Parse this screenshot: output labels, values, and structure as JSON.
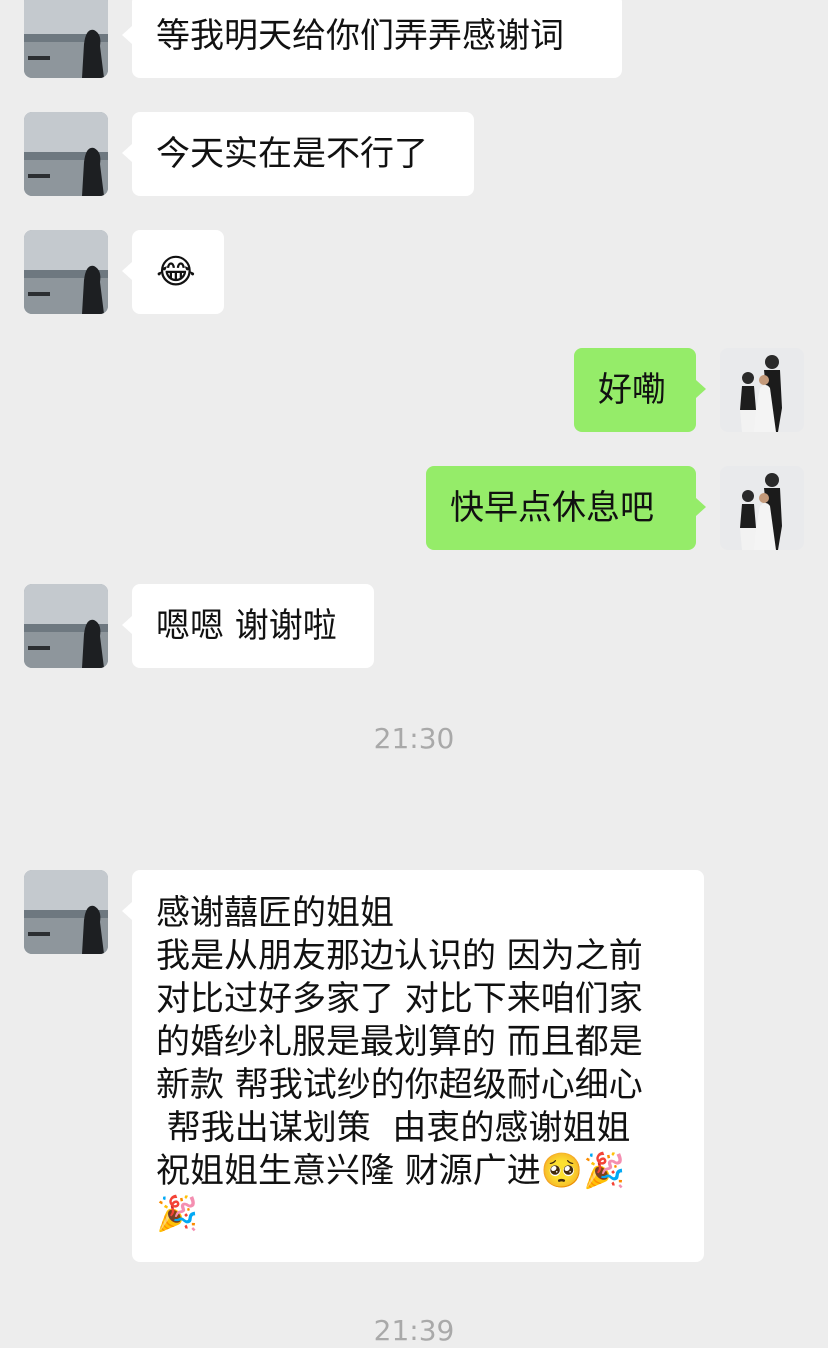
{
  "messages": [
    {
      "id": "m1",
      "side": "left",
      "text": "等我明天给你们弄弄感谢词"
    },
    {
      "id": "m2",
      "side": "left",
      "text": "今天实在是不行了"
    },
    {
      "id": "m3",
      "side": "left",
      "text": "😂"
    },
    {
      "id": "m4",
      "side": "right",
      "text": "好嘞"
    },
    {
      "id": "m5",
      "side": "right",
      "text": "快早点休息吧"
    },
    {
      "id": "m6",
      "side": "left",
      "text": "嗯嗯 谢谢啦"
    },
    {
      "id": "m7",
      "side": "left",
      "lines": [
        "感谢囍匠的姐姐",
        "我是从朋友那边认识的 因为之前",
        "对比过好多家了 对比下来咱们家",
        "的婚纱礼服是最划算的 而且都是",
        "新款 帮我试纱的你超级耐心细心",
        " 帮我出谋划策  由衷的感谢姐姐",
        "祝姐姐生意兴隆 财源广进🥺🎉",
        "🎉"
      ]
    }
  ],
  "timestamps": [
    "21:30",
    "21:39"
  ],
  "colors": {
    "background": "#ededed",
    "left_bubble": "#ffffff",
    "right_bubble": "#95ec69",
    "timestamp": "#a9a9a9"
  },
  "icons": {
    "left_avatar": "seaside-silhouette-avatar",
    "right_avatar": "wedding-couple-avatar"
  }
}
